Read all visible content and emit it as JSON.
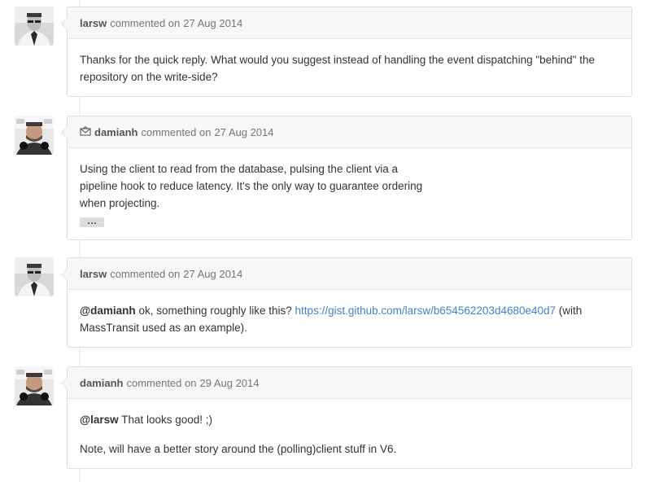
{
  "comments": [
    {
      "author": "larsw",
      "action": "commented on",
      "date": "27 Aug 2014",
      "avatar_icon": "user-avatar",
      "body": "Thanks for the quick reply. What would you suggest instead of handling the event dispatching \"behind\" the repository on the write-side?"
    },
    {
      "author": "damianh",
      "action": "commented on",
      "date": "27 Aug 2014",
      "avatar_icon": "user-avatar",
      "via_icon": "email-reply-icon",
      "body_lines": [
        "Using the client to read from the database, pulsing the client via a",
        "pipeline hook to reduce latency. It's the only way to guarantee ordering",
        "when projecting."
      ],
      "expand_label": "…"
    },
    {
      "author": "larsw",
      "action": "commented on",
      "date": "27 Aug 2014",
      "avatar_icon": "user-avatar",
      "mention": "@damianh",
      "text_before_link": " ok, something roughly like this? ",
      "link": "https://gist.github.com/larsw/b654562203d4680e40d7",
      "text_after_link": " (with MassTransit used as an example)."
    },
    {
      "author": "damianh",
      "action": "commented on",
      "date": "29 Aug 2014",
      "avatar_icon": "user-avatar",
      "mention": "@larsw",
      "text_after_mention": " That looks good! ;)",
      "paragraph2": "Note, will have a better story around the (polling)client stuff in V6."
    }
  ],
  "colors": {
    "link": "#4183c4",
    "header_bg": "#f7f7f7",
    "border": "#dddddd"
  }
}
